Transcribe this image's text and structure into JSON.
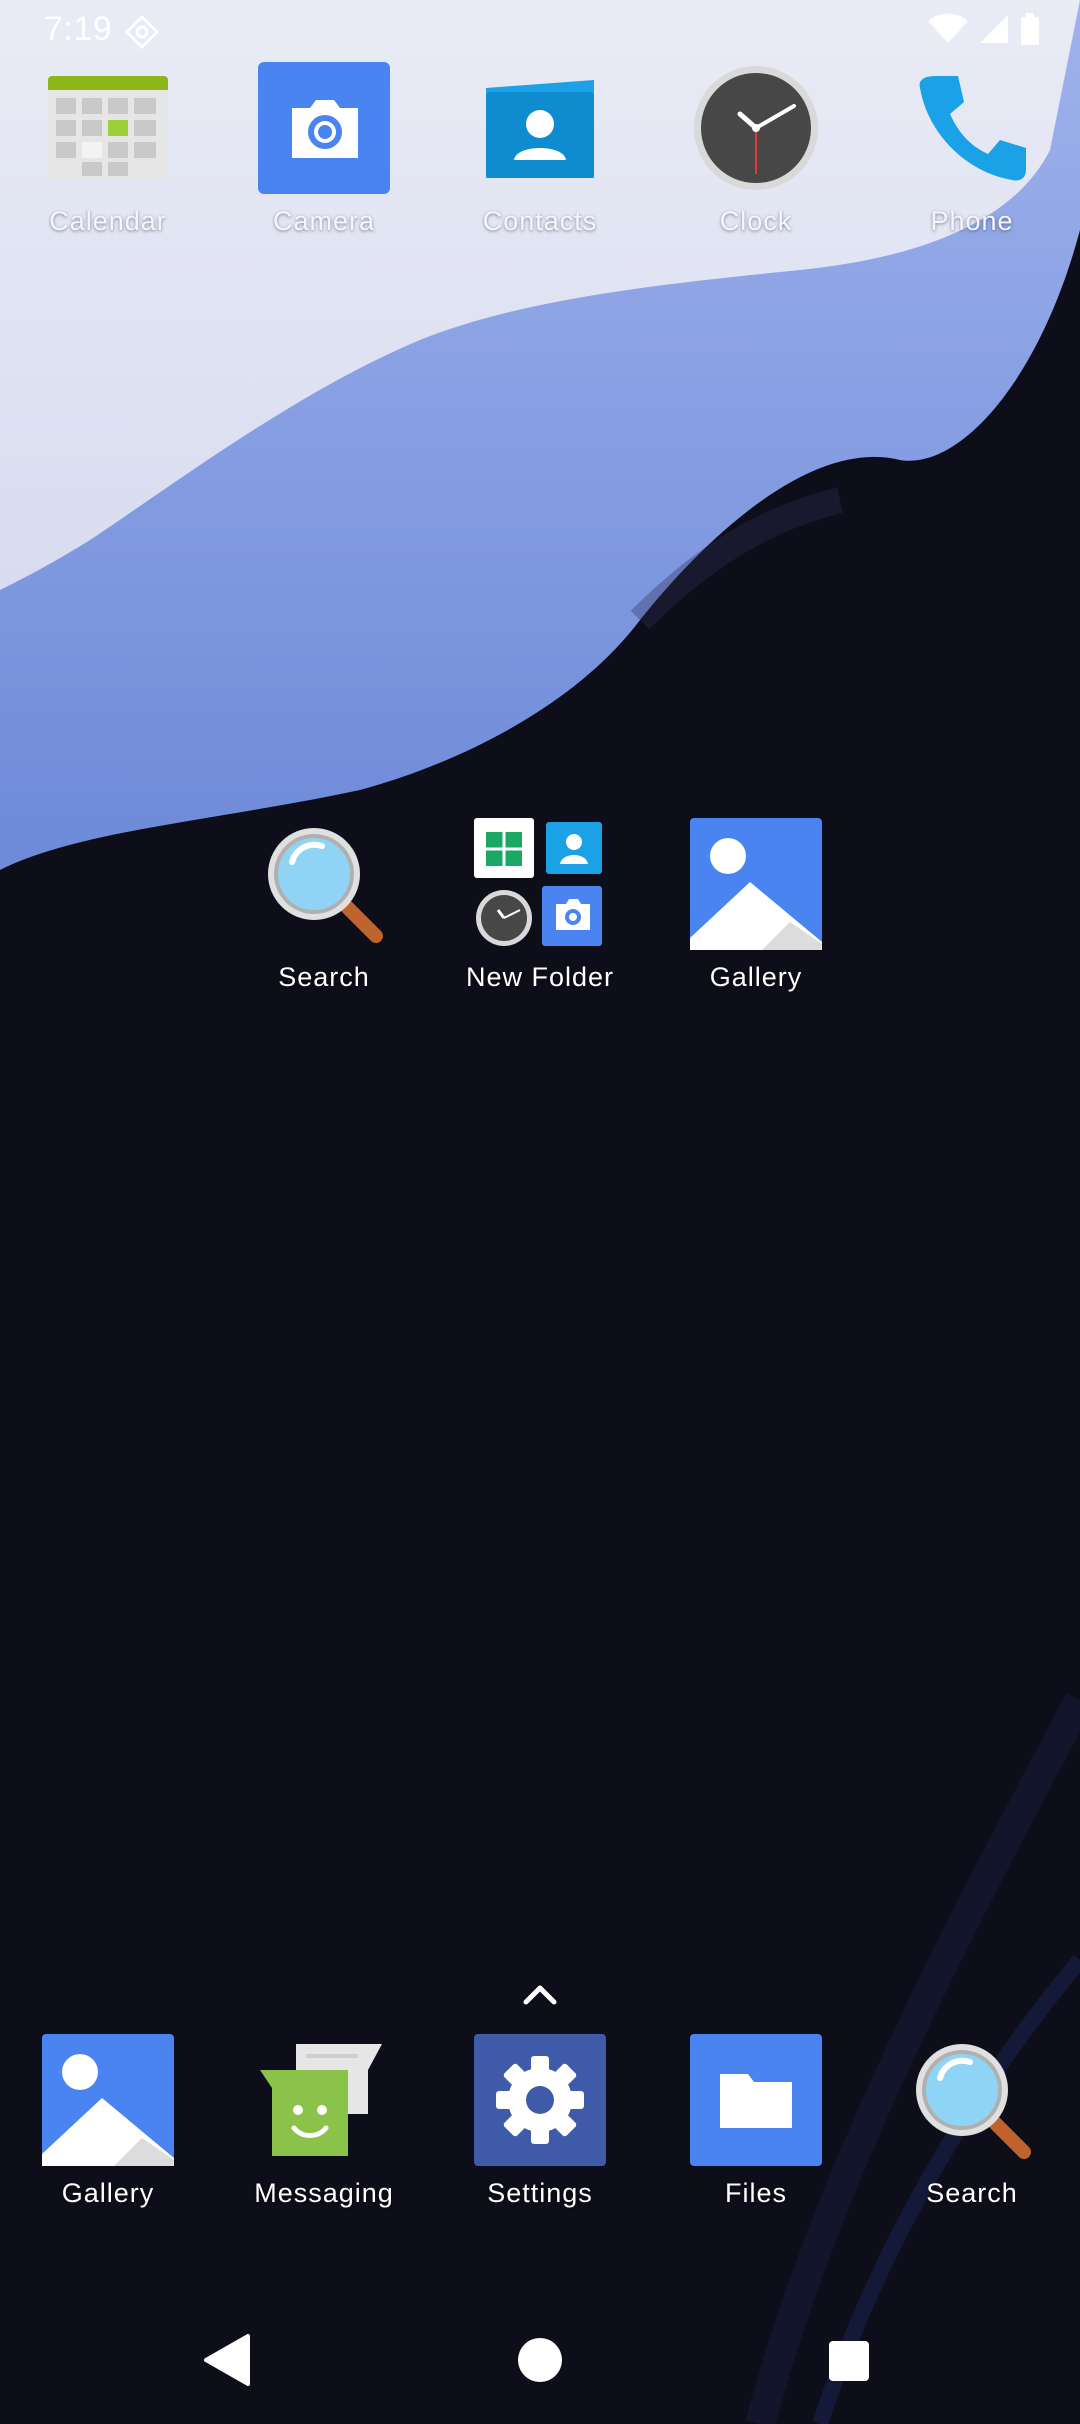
{
  "status_bar": {
    "time": "7:19",
    "icons": [
      "settings-gear-icon",
      "wifi-icon",
      "cellular-signal-icon",
      "battery-icon"
    ]
  },
  "top_row": [
    {
      "label": "Calendar",
      "icon": "calendar-icon"
    },
    {
      "label": "Camera",
      "icon": "camera-icon"
    },
    {
      "label": "Contacts",
      "icon": "contacts-icon"
    },
    {
      "label": "Clock",
      "icon": "clock-icon"
    },
    {
      "label": "Phone",
      "icon": "phone-icon"
    }
  ],
  "middle_row": [
    {
      "label": "Search",
      "icon": "magnifier-icon"
    },
    {
      "label": "New Folder",
      "icon": "folder-preview-icon"
    },
    {
      "label": "Gallery",
      "icon": "gallery-icon"
    }
  ],
  "dock": [
    {
      "label": "Gallery",
      "icon": "gallery-icon"
    },
    {
      "label": "Messaging",
      "icon": "messaging-icon"
    },
    {
      "label": "Settings",
      "icon": "settings-icon"
    },
    {
      "label": "Files",
      "icon": "files-icon"
    },
    {
      "label": "Search",
      "icon": "magnifier-icon"
    }
  ],
  "nav_bar": {
    "buttons": [
      "back-icon",
      "home-icon",
      "recents-icon"
    ]
  },
  "colors": {
    "background": "#0e0e1a",
    "wallpaper_light": "#e7e9f5",
    "wallpaper_blue": "#7e98e3",
    "camera_blue": "#4a84f0",
    "contacts_blue": "#1aa1e6",
    "settings_blue": "#3f5aa8",
    "messaging_green": "#8bc34a"
  }
}
